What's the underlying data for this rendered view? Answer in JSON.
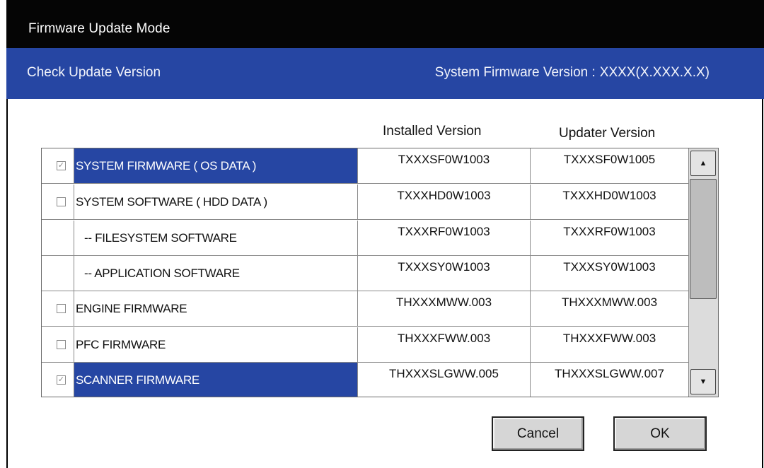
{
  "window": {
    "title": "Firmware Update Mode"
  },
  "header": {
    "subtitle": "Check Update Version",
    "system_firmware_label": "System Firmware Version :",
    "system_firmware_value": "XXXX(X.XXX.X.X)"
  },
  "columns": {
    "installed": "Installed Version",
    "updater": "Updater Version"
  },
  "rows": [
    {
      "name": "SYSTEM FIRMWARE ( OS DATA )",
      "installed": "TXXXSF0W1003",
      "updater": "TXXXSF0W1005",
      "has_checkbox": true,
      "checked": true,
      "selected": true
    },
    {
      "name": "SYSTEM SOFTWARE ( HDD DATA )",
      "installed": "TXXXHD0W1003",
      "updater": "TXXXHD0W1003",
      "has_checkbox": true,
      "checked": false,
      "selected": false
    },
    {
      "name": "-- FILESYSTEM SOFTWARE",
      "installed": "TXXXRF0W1003",
      "updater": "TXXXRF0W1003",
      "has_checkbox": false,
      "checked": false,
      "selected": false
    },
    {
      "name": "-- APPLICATION SOFTWARE",
      "installed": "TXXXSY0W1003",
      "updater": "TXXXSY0W1003",
      "has_checkbox": false,
      "checked": false,
      "selected": false
    },
    {
      "name": "ENGINE FIRMWARE",
      "installed": "THXXXMWW.003",
      "updater": "THXXXMWW.003",
      "has_checkbox": true,
      "checked": false,
      "selected": false
    },
    {
      "name": "PFC FIRMWARE",
      "installed": "THXXXFWW.003",
      "updater": "THXXXFWW.003",
      "has_checkbox": true,
      "checked": false,
      "selected": false
    },
    {
      "name": "SCANNER FIRMWARE",
      "installed": "THXXXSLGWW.005",
      "updater": "THXXXSLGWW.007",
      "has_checkbox": true,
      "checked": true,
      "selected": true
    }
  ],
  "buttons": {
    "cancel": "Cancel",
    "ok": "OK"
  },
  "icons": {
    "scroll_up": "triangle-up-icon",
    "scroll_down": "triangle-down-icon",
    "check": "checkmark-icon"
  },
  "colors": {
    "titlebar": "#050505",
    "header": "#2646a3",
    "selection": "#2646a3"
  }
}
